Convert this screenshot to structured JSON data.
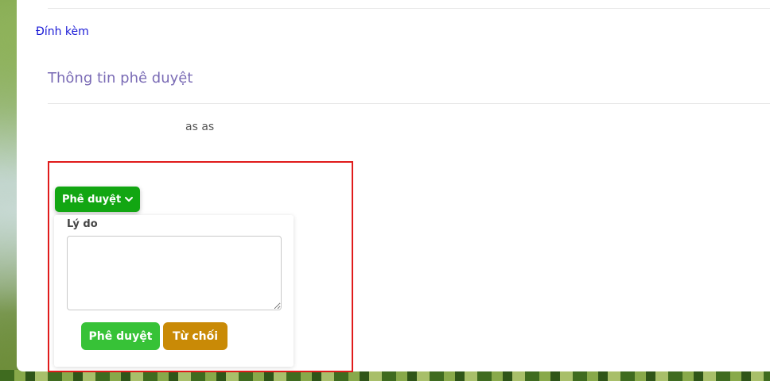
{
  "attachment": {
    "label": "Đính kèm"
  },
  "approval_section": {
    "title": "Thông tin phê duyệt",
    "approver_name": "as as"
  },
  "approval_dropdown": {
    "toggle_label": "Phê duyệt",
    "toggle_icon": "chevron-down-icon",
    "reason_label": "Lý do",
    "reason_value": "",
    "approve_label": "Phê duyệt",
    "reject_label": "Từ chối"
  },
  "colors": {
    "section_title": "#7a6bb5",
    "link": "#1a1ad6",
    "toggle_bg": "#12a612",
    "approve_bg": "#37c237",
    "reject_bg": "#c98a06",
    "highlight_border": "#e01b1b"
  }
}
